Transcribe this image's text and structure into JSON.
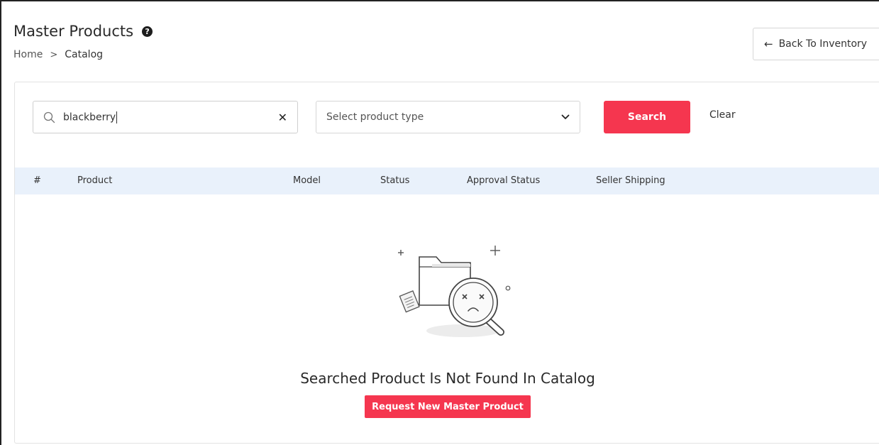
{
  "header": {
    "title": "Master Products",
    "help_icon": "?",
    "breadcrumb": {
      "home": "Home",
      "separator": ">",
      "current": "Catalog"
    },
    "back_button": {
      "arrow": "←",
      "label": "Back To Inventory"
    }
  },
  "filters": {
    "search_value": "blackberry",
    "clear_icon": "✕",
    "product_type_placeholder": "Select product type",
    "search_label": "Search",
    "clear_label": "Clear"
  },
  "table": {
    "columns": [
      "#",
      "Product",
      "Model",
      "Status",
      "Approval Status",
      "Seller Shipping"
    ],
    "rows": []
  },
  "empty_state": {
    "illustration_icon": "folder-not-found-icon",
    "message": "Searched Product Is Not Found In Catalog",
    "request_button": "Request New Master Product"
  },
  "colors": {
    "accent": "#f5364f",
    "table_header_bg": "#e9f1fb"
  }
}
